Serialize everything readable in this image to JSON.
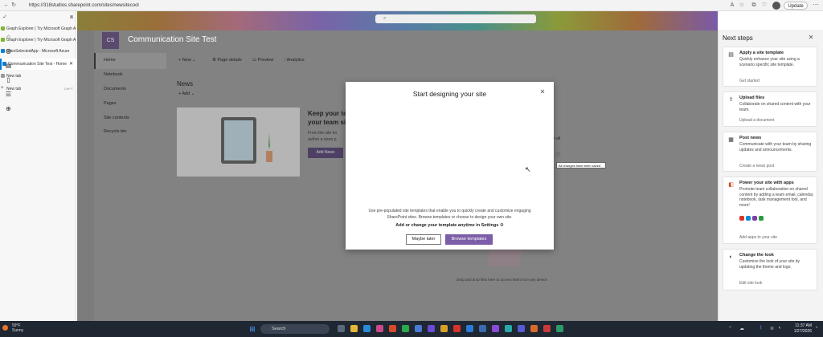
{
  "browser": {
    "url": "https://318studios.sharepoint.com/sites/newsitecool",
    "search_placeholder": "",
    "update_label": "Update"
  },
  "tabs": [
    {
      "label": "Graph Explorer | Try Microsoft Graph A",
      "color": "#7cb82f"
    },
    {
      "label": "Graph Explorer | Try Microsoft Graph A",
      "color": "#7cb82f"
    },
    {
      "label": "SitesSelectedApp - Microsoft Azure",
      "color": "#0a7fd6"
    },
    {
      "label": "Communication Site Test - Home",
      "color": "#0a7fd6"
    },
    {
      "label": "New tab",
      "color": "#999999"
    },
    {
      "label": "New tab",
      "shortcut": "Ctrl+T"
    }
  ],
  "site": {
    "initials": "CS",
    "title": "Communication Site Test"
  },
  "leftnav": [
    "Home",
    "Notebook",
    "Documents",
    "Pages",
    "Site contents",
    "Recycle bin"
  ],
  "commands": [
    "New",
    "Page details",
    "Preview",
    "Analytics"
  ],
  "news": {
    "heading": "News",
    "add_label": "Add",
    "card_title": "Keep your te... your team si...",
    "card_title_lines": [
      "Keep your te",
      "your team si"
    ],
    "card_desc_lines": [
      "From the site ho",
      "author a news p"
    ],
    "add_news_label": "Add News",
    "see_all": "ee all"
  },
  "tooltip": "All changes have been saved",
  "drag_text": "Drag and drop files here to access them from any device.",
  "modal": {
    "title": "Start designing your site",
    "description": "Use pre-populated site templates that enable you to quickly create and customize engaging SharePoint sites. Browse templates or choose to design your own site.",
    "hint": "Add or change your template anytime in Settings",
    "maybe_later": "Maybe later",
    "browse": "Browse templates"
  },
  "panel": {
    "title": "Next steps",
    "cards": [
      {
        "title": "Apply a site template",
        "desc": "Quickly enhance your site using a scenario specific site template.",
        "link": "Get started"
      },
      {
        "title": "Upload files",
        "desc": "Collaborate on shared content with your team.",
        "link": "Upload a document"
      },
      {
        "title": "Post news",
        "desc": "Communicate with your team by sharing updates and announcements.",
        "link": "Create a news post"
      },
      {
        "title": "Power your site with apps",
        "desc": "Promote team collaboration on shared content by adding a team email, calendar, notebook, task management tool, and more!",
        "link": "Add apps to your site"
      },
      {
        "title": "Change the look",
        "desc": "Customize the look of your site by updating the theme and logo.",
        "link": "Edit site look"
      }
    ]
  },
  "taskbar": {
    "weather_temp": "59°F",
    "weather_desc": "Sunny",
    "search_label": "Search",
    "time": "11:37 AM",
    "date": "1/27/2026"
  }
}
